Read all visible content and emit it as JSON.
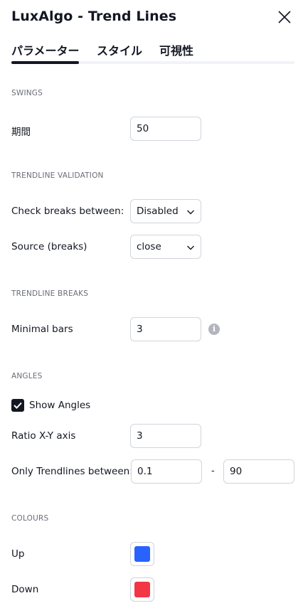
{
  "header": {
    "title": "LuxAlgo - Trend Lines"
  },
  "tabs": [
    {
      "label": "パラメーター",
      "active": true
    },
    {
      "label": "スタイル",
      "active": false
    },
    {
      "label": "可視性",
      "active": false
    }
  ],
  "sections": {
    "swings": {
      "title": "SWINGS",
      "period": {
        "label": "期間",
        "value": "50"
      }
    },
    "trendline_validation": {
      "title": "TRENDLINE VALIDATION",
      "check_breaks": {
        "label": "Check breaks between:",
        "value": "Disabled"
      },
      "source": {
        "label": "Source (breaks)",
        "value": "close"
      }
    },
    "trendline_breaks": {
      "title": "TRENDLINE BREAKS",
      "minimal_bars": {
        "label": "Minimal bars",
        "value": "3",
        "info_icon": "i"
      }
    },
    "angles": {
      "title": "ANGLES",
      "show_angles": {
        "label": "Show Angles",
        "checked": true
      },
      "ratio": {
        "label": "Ratio X-Y axis",
        "value": "3"
      },
      "only_between": {
        "label": "Only Trendlines between:",
        "min": "0.1",
        "separator": "-",
        "max": "90"
      }
    },
    "colours": {
      "title": "COLOURS",
      "up": {
        "label": "Up",
        "color": "#2962ff"
      },
      "down": {
        "label": "Down",
        "color": "#f23645"
      }
    }
  },
  "icons": {
    "close": "close-icon",
    "chevron": "chevron-down-icon",
    "info": "info-icon",
    "check": "check-icon"
  }
}
